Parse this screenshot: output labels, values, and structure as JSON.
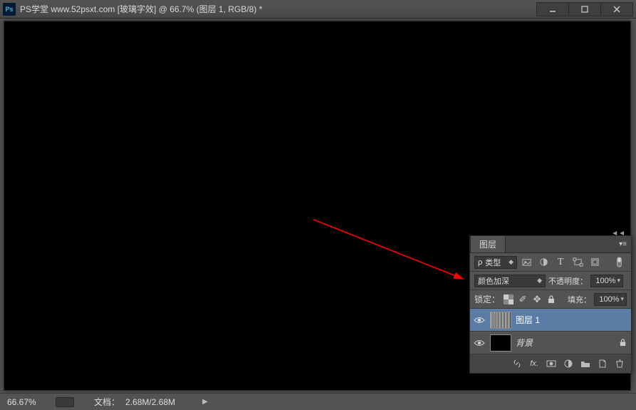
{
  "titlebar": {
    "app_icon": "Ps",
    "title": "PS学堂 www.52psxt.com [玻璃字效] @ 66.7% (图层 1, RGB/8) *"
  },
  "statusbar": {
    "zoom": "66.67%",
    "doc_label": "文档：",
    "doc_size": "2.68M/2.68M"
  },
  "panel": {
    "tab_label": "图层",
    "kind_label": "类型",
    "blend_mode": "颜色加深",
    "opacity_label": "不透明度：",
    "opacity_value": "100%",
    "lock_label": "锁定：",
    "fill_label": "填充：",
    "fill_value": "100%",
    "layers": [
      {
        "name": "图层 1",
        "visible": true,
        "selected": true,
        "thumb": "fibers",
        "locked": false
      },
      {
        "name": "背景",
        "visible": true,
        "selected": false,
        "thumb": "black",
        "locked": true,
        "italic": true
      }
    ],
    "fx_label": "fx."
  }
}
